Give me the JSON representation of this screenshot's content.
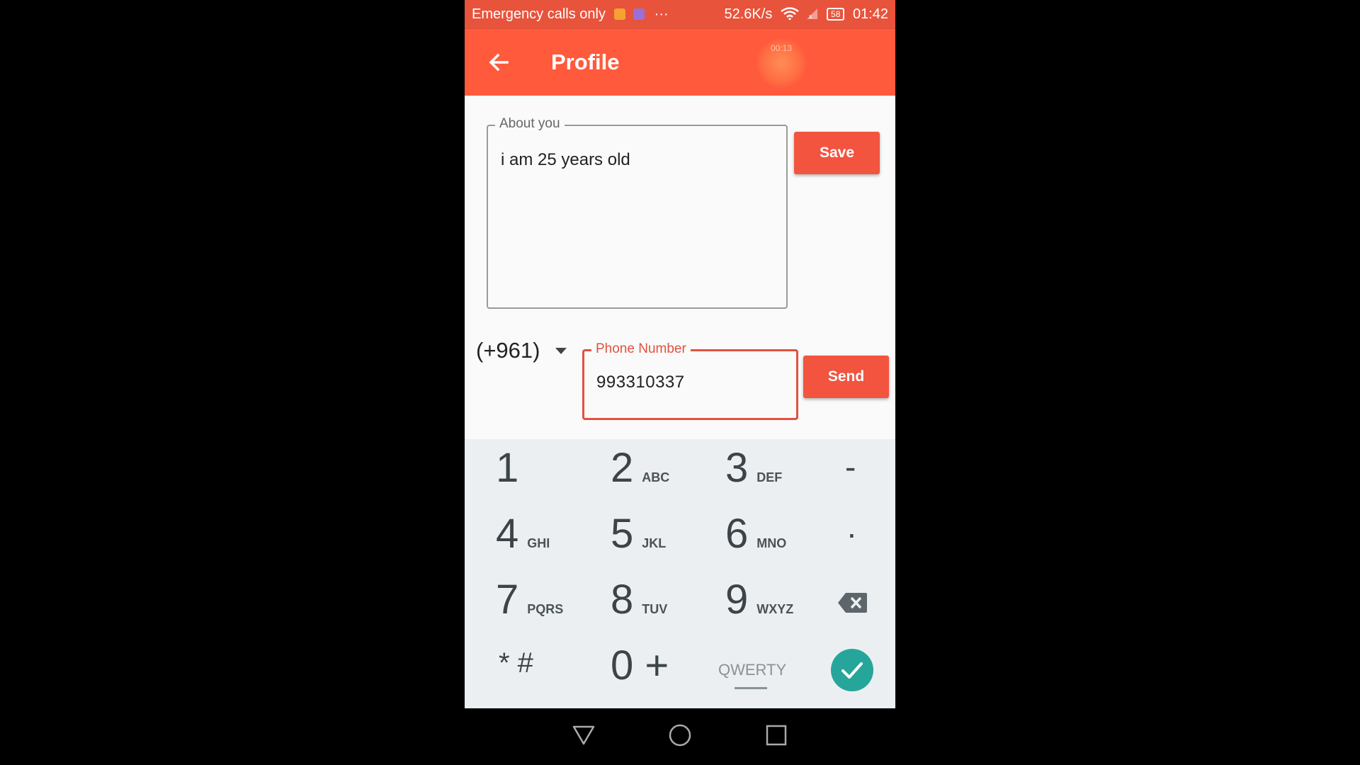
{
  "status_bar": {
    "carrier_text": "Emergency calls only",
    "overflow": "···",
    "net_speed": "52.6K/s",
    "battery": "58",
    "time": "01:42"
  },
  "app_bar": {
    "title": "Profile",
    "recording_timer": "00:13"
  },
  "about": {
    "label": "About you",
    "value": "i am 25 years old",
    "save_label": "Save"
  },
  "phone": {
    "country_code": "(+961)",
    "label": "Phone Number",
    "value": "993310337",
    "send_label": "Send"
  },
  "keypad": {
    "rows": [
      [
        {
          "d": "1",
          "l": ""
        },
        {
          "d": "2",
          "l": "ABC"
        },
        {
          "d": "3",
          "l": "DEF"
        },
        {
          "d": "-",
          "l": ""
        }
      ],
      [
        {
          "d": "4",
          "l": "GHI"
        },
        {
          "d": "5",
          "l": "JKL"
        },
        {
          "d": "6",
          "l": "MNO"
        },
        {
          "d": ".",
          "l": ""
        }
      ],
      [
        {
          "d": "7",
          "l": "PQRS"
        },
        {
          "d": "8",
          "l": "TUV"
        },
        {
          "d": "9",
          "l": "WXYZ"
        },
        {
          "d": "",
          "l": ""
        }
      ],
      [
        {
          "d": "* #",
          "l": ""
        },
        {
          "d": "0 +",
          "l": ""
        },
        {
          "d": "",
          "l": ""
        },
        {
          "d": "",
          "l": ""
        }
      ]
    ],
    "qwerty_label": "QWERTY"
  },
  "colors": {
    "app_bar": "#ff5a3c",
    "accent": "#f25440",
    "done": "#26a69a"
  }
}
